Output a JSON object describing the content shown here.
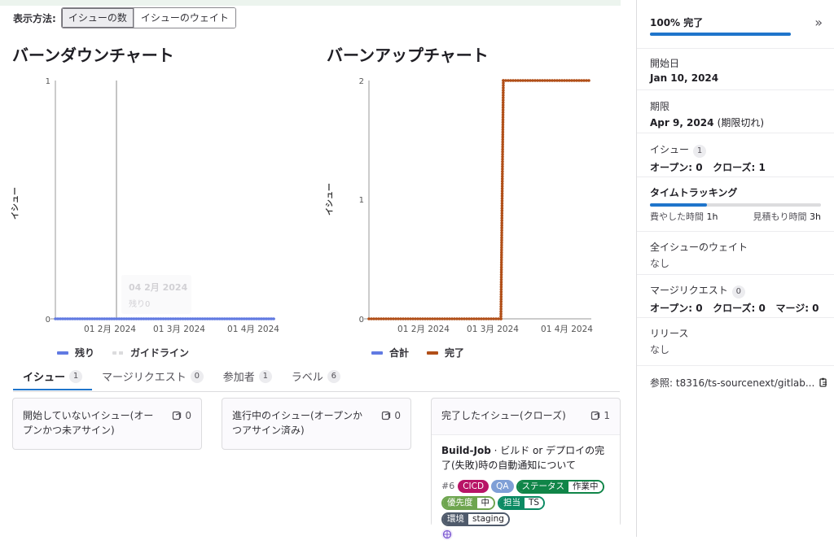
{
  "view_toggle": {
    "label": "表示方法:",
    "options": [
      "イシューの数",
      "イシューのウェイト"
    ],
    "active_index": 0
  },
  "burndown": {
    "title": "バーンダウンチャート",
    "legend": [
      "残り",
      "ガイドライン"
    ],
    "tooltip": {
      "date": "04 2月 2024",
      "text": "残り0"
    }
  },
  "burnup": {
    "title": "バーンアップチャート",
    "legend": [
      "合計",
      "完了"
    ]
  },
  "chart_data": [
    {
      "type": "line",
      "title": "バーンダウンチャート",
      "ylabel": "イシュー",
      "xlabel": "",
      "x_tick_labels": [
        "01 2月 2024",
        "01 3月 2024",
        "01 4月 2024"
      ],
      "y_ticks": [
        0,
        1
      ],
      "ylim": [
        0,
        1
      ],
      "x": [
        "2024-01-10",
        "2024-04-09"
      ],
      "series": [
        {
          "name": "残り",
          "values": [
            0,
            0
          ],
          "color": "#617ae2"
        }
      ],
      "guideline_date": "2024-02-04",
      "grid": false,
      "legend": "bottom-left"
    },
    {
      "type": "line",
      "title": "バーンアップチャート",
      "ylabel": "イシュー",
      "xlabel": "",
      "x_tick_labels": [
        "01 2月 2024",
        "01 3月 2024",
        "01 4月 2024"
      ],
      "y_ticks": [
        0,
        1,
        2
      ],
      "ylim": [
        0,
        2
      ],
      "x": [
        "2024-01-10",
        "2024-03-04",
        "2024-03-05",
        "2024-04-09"
      ],
      "series": [
        {
          "name": "完了",
          "values": [
            0,
            0,
            2,
            2
          ],
          "color": "#b14f18"
        }
      ],
      "grid": false,
      "legend": "bottom-left"
    }
  ],
  "tabs": [
    {
      "label": "イシュー",
      "count": "1"
    },
    {
      "label": "マージリクエスト",
      "count": "0"
    },
    {
      "label": "参加者",
      "count": "1"
    },
    {
      "label": "ラベル",
      "count": "6"
    }
  ],
  "boards": [
    {
      "title": "開始していないイシュー(オープンかつ未アサイン)",
      "count": "0"
    },
    {
      "title": "進行中のイシュー(オープンかつアサイン済み)",
      "count": "0"
    },
    {
      "title": "完了したイシュー(クローズ)",
      "count": "1"
    }
  ],
  "card": {
    "title_bold": "Build-Job",
    "title_rest": " · ビルド or デプロイの完了(失敗)時の自動通知について",
    "number": "#6",
    "labels": {
      "cicd": "CICD",
      "qa": "QA",
      "status_key": "ステータス",
      "status_val": "作業中",
      "priority_key": "優先度",
      "priority_val": "中",
      "owner_key": "担当",
      "owner_val": "TS",
      "env_key": "環境",
      "env_val": "staging"
    }
  },
  "sidebar": {
    "progress": {
      "text": "100% 完了",
      "percent": 100
    },
    "start": {
      "label": "開始日",
      "value": "Jan 10, 2024"
    },
    "due": {
      "label": "期限",
      "value": "Apr 9, 2024",
      "note": "(期限切れ)"
    },
    "issues": {
      "label": "イシュー",
      "count": "1",
      "open": "オープン: 0",
      "closed": "クローズ: 1"
    },
    "time": {
      "label": "タイムトラッキング",
      "spent_label": "費やした時間",
      "spent": "1h",
      "est_label": "見積もり時間",
      "est": "3h",
      "ratio": 0.333
    },
    "weight": {
      "label": "全イシューのウェイト",
      "value": "なし"
    },
    "mr": {
      "label": "マージリクエスト",
      "count": "0",
      "open": "オープン: 0",
      "closed": "クローズ: 0",
      "merged": "マージ: 0"
    },
    "release": {
      "label": "リリース",
      "value": "なし"
    },
    "reference": {
      "text": "参照: t8316/ts-sourcenext/gitlab..."
    }
  }
}
